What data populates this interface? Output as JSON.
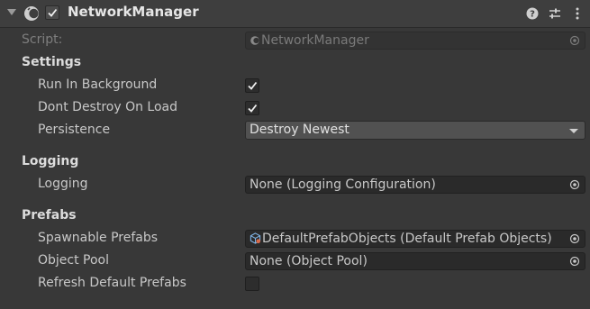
{
  "component": {
    "title": "NetworkManager",
    "enabled": true
  },
  "script": {
    "label": "Script:",
    "value": "NetworkManager"
  },
  "sections": {
    "settings": "Settings",
    "logging": "Logging",
    "prefabs": "Prefabs"
  },
  "settings": {
    "run_in_background_label": "Run In Background",
    "run_in_background": true,
    "dont_destroy_label": "Dont Destroy On Load",
    "dont_destroy": true,
    "persistence_label": "Persistence",
    "persistence_value": "Destroy Newest"
  },
  "logging": {
    "label": "Logging",
    "value": "None (Logging Configuration)"
  },
  "prefabs": {
    "spawnable_label": "Spawnable Prefabs",
    "spawnable_value": "DefaultPrefabObjects (Default Prefab Objects)",
    "object_pool_label": "Object Pool",
    "object_pool_value": "None (Object Pool)",
    "refresh_label": "Refresh Default Prefabs",
    "refresh": false
  },
  "icons": {
    "component": "network-manager-icon",
    "help": "help-icon",
    "presets": "presets-icon",
    "menu": "kebab-menu-icon",
    "picker": "object-picker-icon"
  }
}
